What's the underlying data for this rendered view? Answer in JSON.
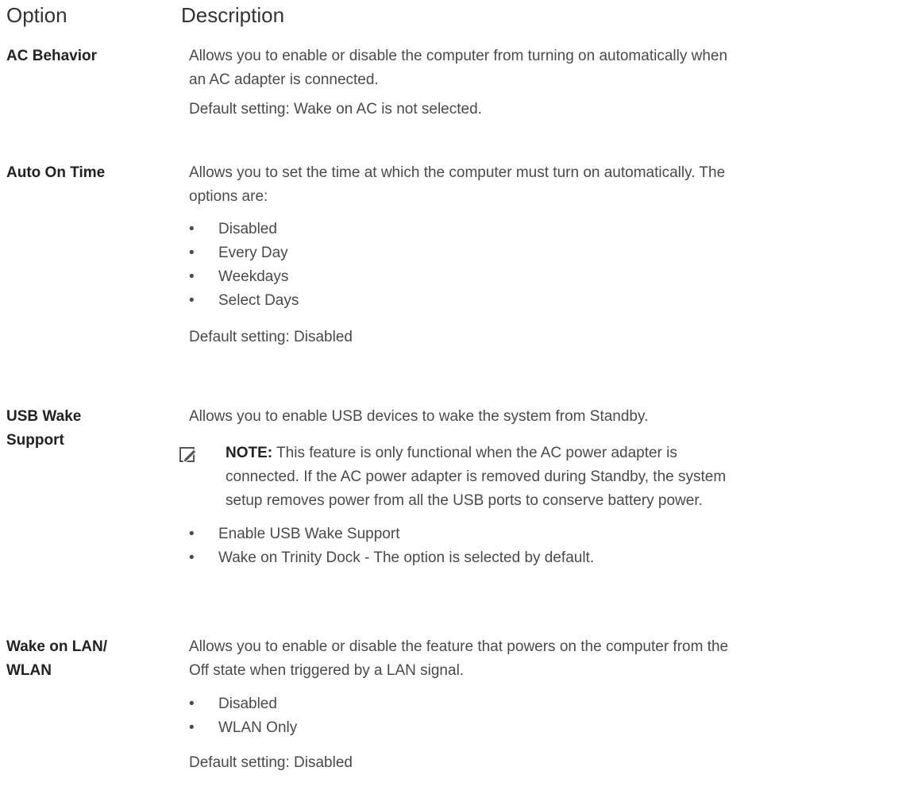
{
  "header": {
    "option": "Option",
    "description": "Description"
  },
  "rows": [
    {
      "option": "AC Behavior",
      "desc1": "Allows you to enable or disable the computer from turning on automatically when",
      "desc2": "an AC adapter is connected.",
      "default": "Default setting: Wake on AC is not selected."
    },
    {
      "option": "Auto On Time",
      "desc1": "Allows you to set the time at which the computer must turn on automatically. The",
      "desc2": "options are:",
      "items": [
        "Disabled",
        "Every Day",
        "Weekdays",
        "Select Days"
      ],
      "default": "Default setting: Disabled"
    },
    {
      "option_line1": "USB Wake",
      "option_line2": "Support",
      "desc1": "Allows you to enable USB devices to wake the system from Standby.",
      "note_label": "NOTE:",
      "note1": "This feature is only functional when the AC power adapter is",
      "note2": "connected. If the AC power adapter is removed during Standby, the system",
      "note3": "setup removes power from all the USB ports to conserve battery power.",
      "items": [
        "Enable USB Wake Support",
        "Wake on Trinity Dock - The option is selected by default."
      ]
    },
    {
      "option_line1": "Wake on LAN/",
      "option_line2": "WLAN",
      "desc1": "Allows you to enable or disable the feature that powers on the computer from the",
      "desc2": "Off state when triggered by a LAN signal.",
      "items": [
        "Disabled",
        "WLAN Only"
      ],
      "default": "Default setting: Disabled"
    }
  ],
  "icons": {
    "note": "pencil-note-icon"
  }
}
